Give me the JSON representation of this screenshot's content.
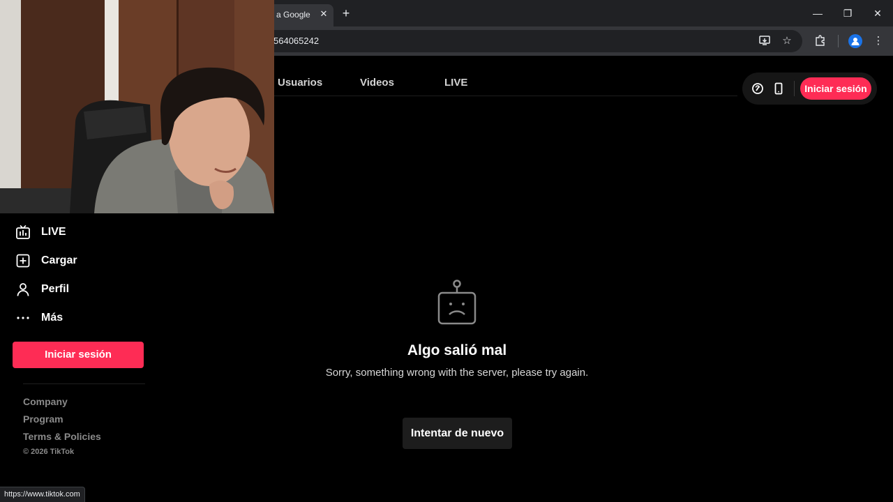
{
  "browser": {
    "tab_title": "a Google",
    "tab_close": "✕",
    "new_tab": "+",
    "url_fragment": "564065242",
    "window": {
      "minimize": "—",
      "restore": "❐",
      "close": "✕"
    }
  },
  "search_tabs": [
    "Usuarios",
    "Videos",
    "LIVE"
  ],
  "header": {
    "login_label": "Iniciar sesión"
  },
  "sidebar": {
    "items": [
      {
        "label": "LIVE",
        "icon": "live-tv-icon"
      },
      {
        "label": "Cargar",
        "icon": "upload-plus-icon"
      },
      {
        "label": "Perfil",
        "icon": "person-icon"
      },
      {
        "label": "Más",
        "icon": "more-dots-icon"
      }
    ],
    "login_label": "Iniciar sesión",
    "footer_links": [
      "Company",
      "Program",
      "Terms & Policies"
    ],
    "copyright": "© 2026 TikTok"
  },
  "error": {
    "title": "Algo salió mal",
    "message": "Sorry, something wrong with the server, please try again.",
    "retry_label": "Intentar de nuevo"
  },
  "status_bar": {
    "url": "https://www.tiktok.com"
  },
  "colors": {
    "accent": "#fe2c55",
    "background": "#000000",
    "chrome_dark": "#202124",
    "chrome_toolbar": "#35363a"
  }
}
